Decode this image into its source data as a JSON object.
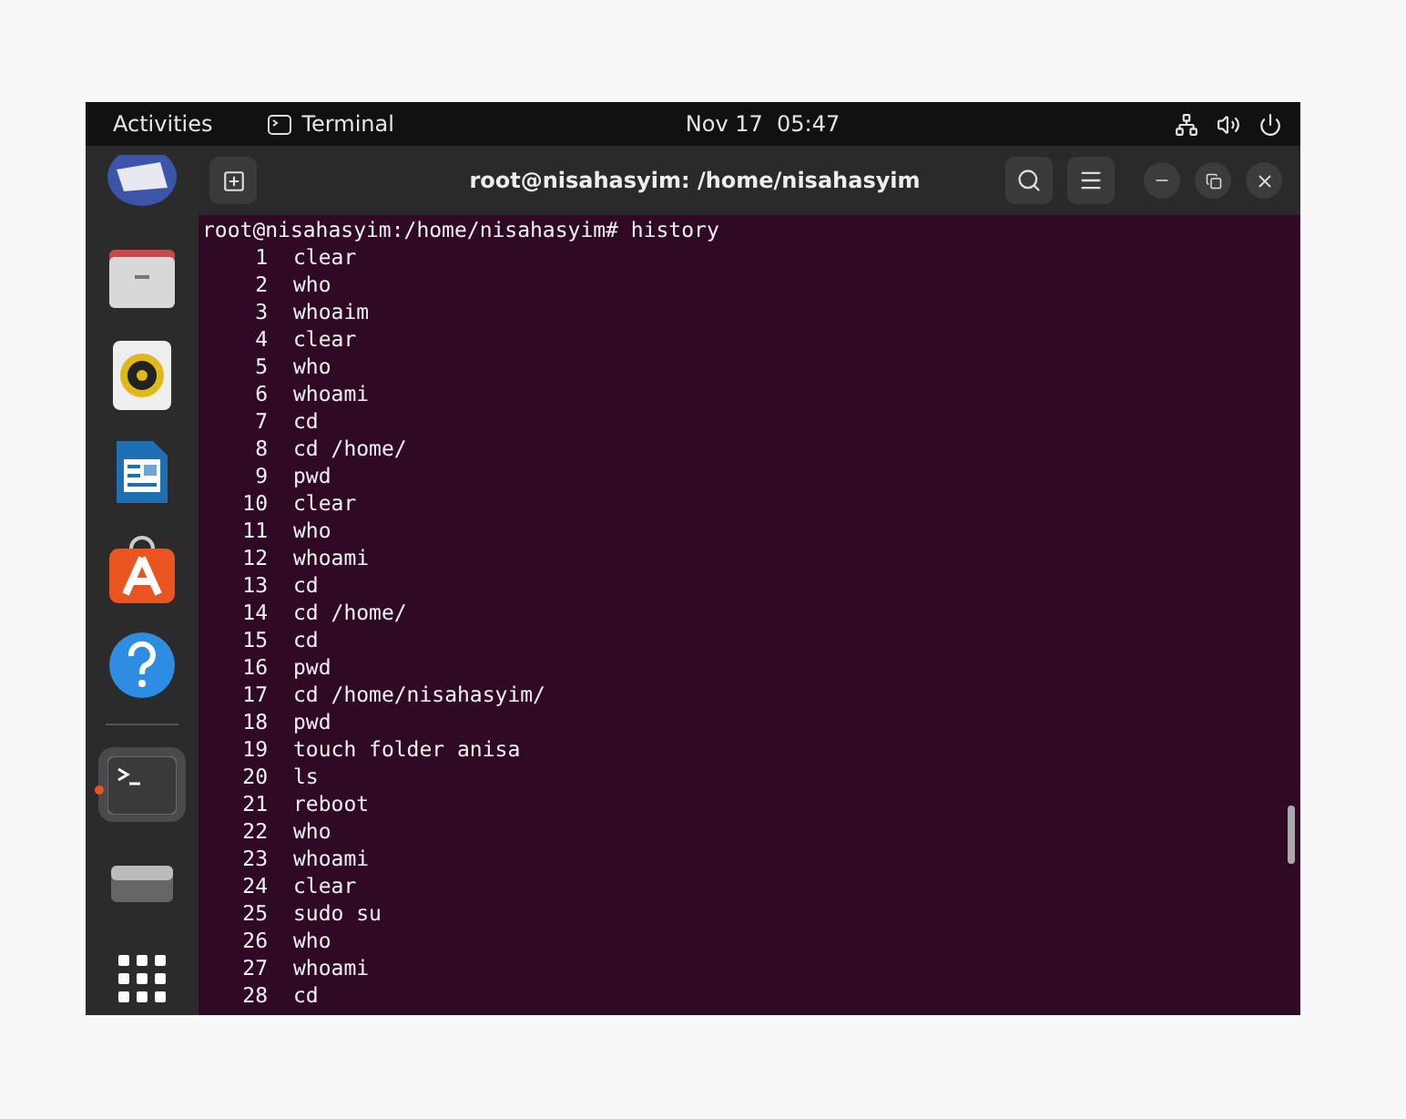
{
  "top_bar": {
    "activities": "Activities",
    "app": "Terminal",
    "clock": "Nov 17  05:47"
  },
  "dock": {
    "items": [
      {
        "kind": "disc",
        "active": false
      },
      {
        "kind": "folder",
        "active": false
      },
      {
        "kind": "speaker",
        "active": false
      },
      {
        "kind": "document",
        "active": false
      },
      {
        "kind": "store",
        "active": false
      },
      {
        "kind": "help",
        "active": false
      },
      {
        "kind": "separator"
      },
      {
        "kind": "terminal",
        "active": true
      },
      {
        "kind": "drive",
        "active": false
      },
      {
        "kind": "grid",
        "active": false
      }
    ]
  },
  "terminal": {
    "title": "root@nisahasyim: /home/nisahasyim",
    "prompt_line": "root@nisahasyim:/home/nisahasyim# history",
    "history": [
      {
        "number": "1",
        "command": "clear"
      },
      {
        "number": "2",
        "command": "who"
      },
      {
        "number": "3",
        "command": "whoaim"
      },
      {
        "number": "4",
        "command": "clear"
      },
      {
        "number": "5",
        "command": "who"
      },
      {
        "number": "6",
        "command": "whoami"
      },
      {
        "number": "7",
        "command": "cd"
      },
      {
        "number": "8",
        "command": "cd /home/"
      },
      {
        "number": "9",
        "command": "pwd"
      },
      {
        "number": "10",
        "command": "clear"
      },
      {
        "number": "11",
        "command": "who"
      },
      {
        "number": "12",
        "command": "whoami"
      },
      {
        "number": "13",
        "command": "cd"
      },
      {
        "number": "14",
        "command": "cd /home/"
      },
      {
        "number": "15",
        "command": "cd"
      },
      {
        "number": "16",
        "command": "pwd"
      },
      {
        "number": "17",
        "command": "cd /home/nisahasyim/"
      },
      {
        "number": "18",
        "command": "pwd"
      },
      {
        "number": "19",
        "command": "touch folder anisa"
      },
      {
        "number": "20",
        "command": "ls"
      },
      {
        "number": "21",
        "command": "reboot"
      },
      {
        "number": "22",
        "command": "who"
      },
      {
        "number": "23",
        "command": "whoami"
      },
      {
        "number": "24",
        "command": "clear"
      },
      {
        "number": "25",
        "command": "sudo su"
      },
      {
        "number": "26",
        "command": "who"
      },
      {
        "number": "27",
        "command": "whoami"
      },
      {
        "number": "28",
        "command": "cd"
      }
    ]
  }
}
